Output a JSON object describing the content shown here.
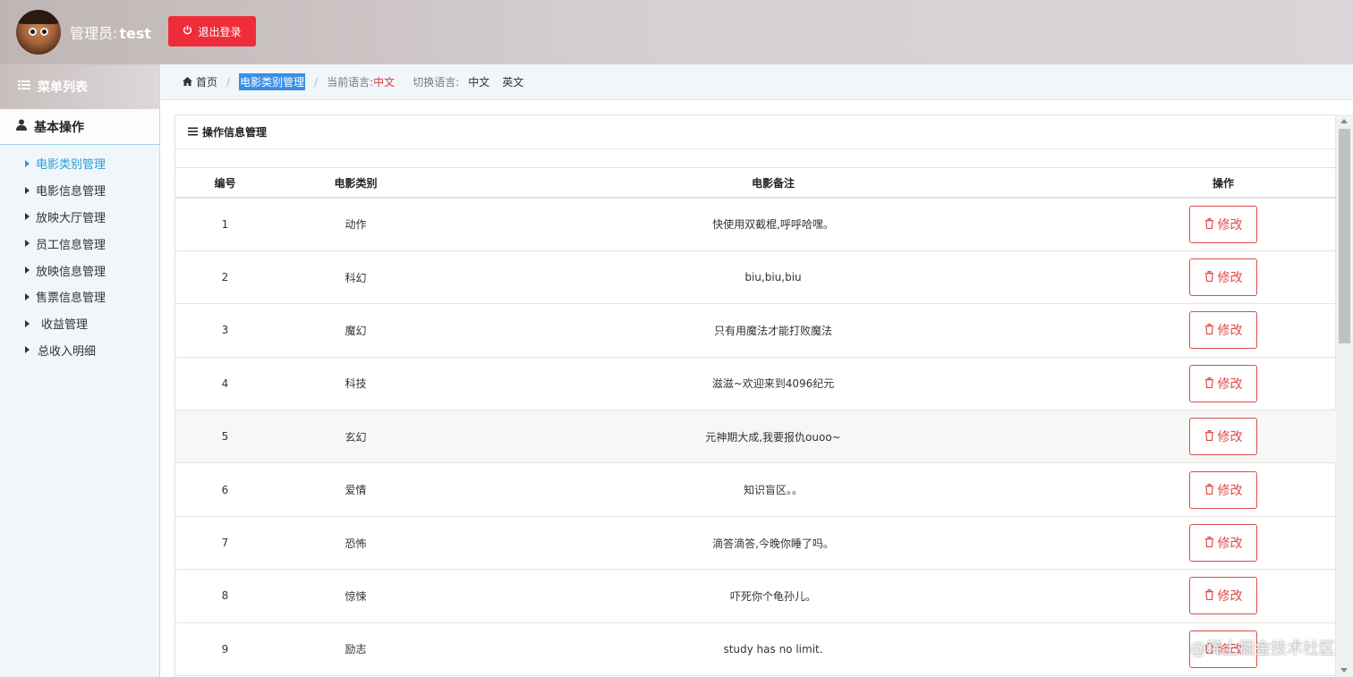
{
  "header": {
    "admin_prefix": "管理员:",
    "admin_name": "test",
    "logout_label": "退出登录",
    "accent": "#ee2d3a"
  },
  "sidebar": {
    "menu_title": "菜单列表",
    "group_title": "基本操作",
    "items": [
      {
        "label": "电影类别管理",
        "active": true
      },
      {
        "label": "电影信息管理"
      },
      {
        "label": "放映大厅管理"
      },
      {
        "label": "员工信息管理"
      },
      {
        "label": "放映信息管理"
      },
      {
        "label": "售票信息管理"
      },
      {
        "label": "收益管理"
      },
      {
        "label": "总收入明细"
      }
    ]
  },
  "breadcrumb": {
    "home": "首页",
    "current": "电影类别管理",
    "lang_label": "当前语言:",
    "lang_value": "中文",
    "switch_label": "切换语言:",
    "lang_zh": "中文",
    "lang_en": "英文"
  },
  "panel": {
    "title": "操作信息管理",
    "columns": [
      "编号",
      "电影类别",
      "电影备注",
      "操作"
    ],
    "edit_label": "修改",
    "rows": [
      {
        "id": "1",
        "type": "动作",
        "note": "快使用双截棍,呼呼哈嘿。"
      },
      {
        "id": "2",
        "type": "科幻",
        "note": "biu,biu,biu"
      },
      {
        "id": "3",
        "type": "魔幻",
        "note": "只有用魔法才能打败魔法"
      },
      {
        "id": "4",
        "type": "科技",
        "note": "滋滋~欢迎来到4096纪元"
      },
      {
        "id": "5",
        "type": "玄幻",
        "note": "元神期大成,我要报仇ouoo~"
      },
      {
        "id": "6",
        "type": "爱情",
        "note": "知识盲区。。"
      },
      {
        "id": "7",
        "type": "恐怖",
        "note": "滴答滴答,今晚你睡了吗。"
      },
      {
        "id": "8",
        "type": "惊悚",
        "note": "吓死你个龟孙儿。"
      },
      {
        "id": "9",
        "type": "励志",
        "note": "study has no limit."
      }
    ]
  },
  "watermark": "@稀土掘金技术社区"
}
